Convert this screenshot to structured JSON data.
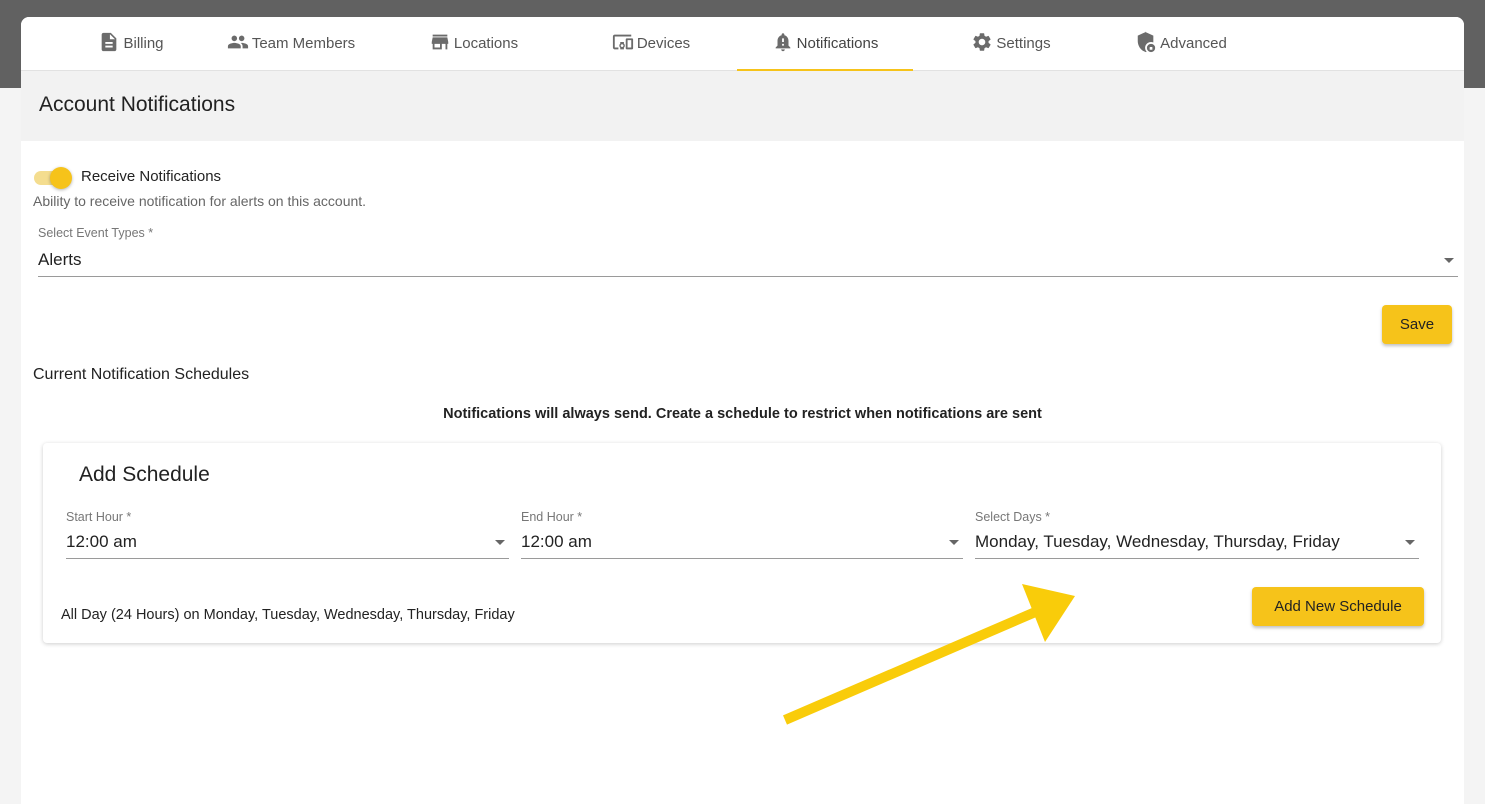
{
  "tabs": [
    {
      "label": "Billing",
      "icon": "document-icon"
    },
    {
      "label": "Team Members",
      "icon": "people-icon"
    },
    {
      "label": "Locations",
      "icon": "store-icon"
    },
    {
      "label": "Devices",
      "icon": "devices-icon"
    },
    {
      "label": "Notifications",
      "icon": "bell-alert-icon",
      "active": true
    },
    {
      "label": "Settings",
      "icon": "gear-icon"
    },
    {
      "label": "Advanced",
      "icon": "shield-lock-icon"
    }
  ],
  "page_title": "Account Notifications",
  "receive": {
    "label": "Receive Notifications",
    "enabled": true,
    "description": "Ability to receive notification for alerts on this account."
  },
  "event_types": {
    "label": "Select Event Types *",
    "value": "Alerts"
  },
  "save_label": "Save",
  "schedules": {
    "title": "Current Notification Schedules",
    "info": "Notifications will always send. Create a schedule to restrict when notifications are sent"
  },
  "add_schedule": {
    "title": "Add Schedule",
    "start_hour": {
      "label": "Start Hour *",
      "value": "12:00 am"
    },
    "end_hour": {
      "label": "End Hour *",
      "value": "12:00 am"
    },
    "days": {
      "label": "Select Days *",
      "value": "Monday, Tuesday, Wednesday, Thursday, Friday"
    },
    "summary": "All Day (24 Hours) on Monday, Tuesday, Wednesday, Thursday, Friday",
    "button_label": "Add New Schedule"
  },
  "colors": {
    "accent": "#f6c31a",
    "arrow": "#f9cc0a",
    "header_bg": "#616161"
  }
}
